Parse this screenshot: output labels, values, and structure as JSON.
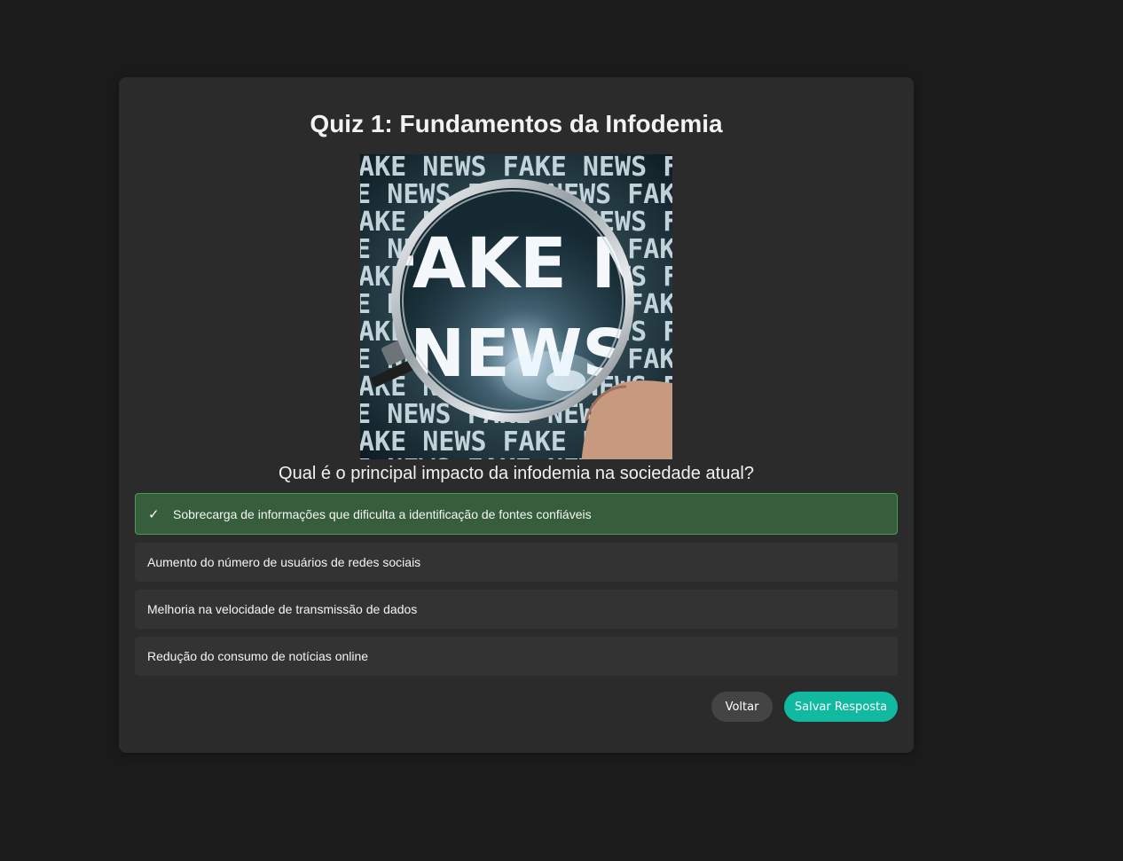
{
  "quiz": {
    "title": "Quiz 1: Fundamentos da Infodemia",
    "image": {
      "icon": "fake-news-magnifier-image",
      "big_word_1": "FAKE N",
      "big_word_2": "NEWS",
      "pattern_text": "FAKE NEWS"
    },
    "question": "Qual é o principal impacto da infodemia na sociedade atual?",
    "options": [
      {
        "label": "Sobrecarga de informações que dificulta a identificação de fontes confiáveis",
        "selected": true,
        "mark": "✓"
      },
      {
        "label": "Aumento do número de usuários de redes sociais",
        "selected": false
      },
      {
        "label": "Melhoria na velocidade de transmissão de dados",
        "selected": false
      },
      {
        "label": "Redução do consumo de notícias online",
        "selected": false
      }
    ],
    "buttons": {
      "back": "Voltar",
      "save": "Salvar Resposta"
    }
  },
  "colors": {
    "page_bg": "#1b1b1b",
    "card_bg": "#2b2b2b",
    "option_bg": "#333333",
    "selected_bg": "#365e3c",
    "selected_border": "#4d9a55",
    "save_button": "#10b9a0",
    "back_button": "#444444"
  }
}
